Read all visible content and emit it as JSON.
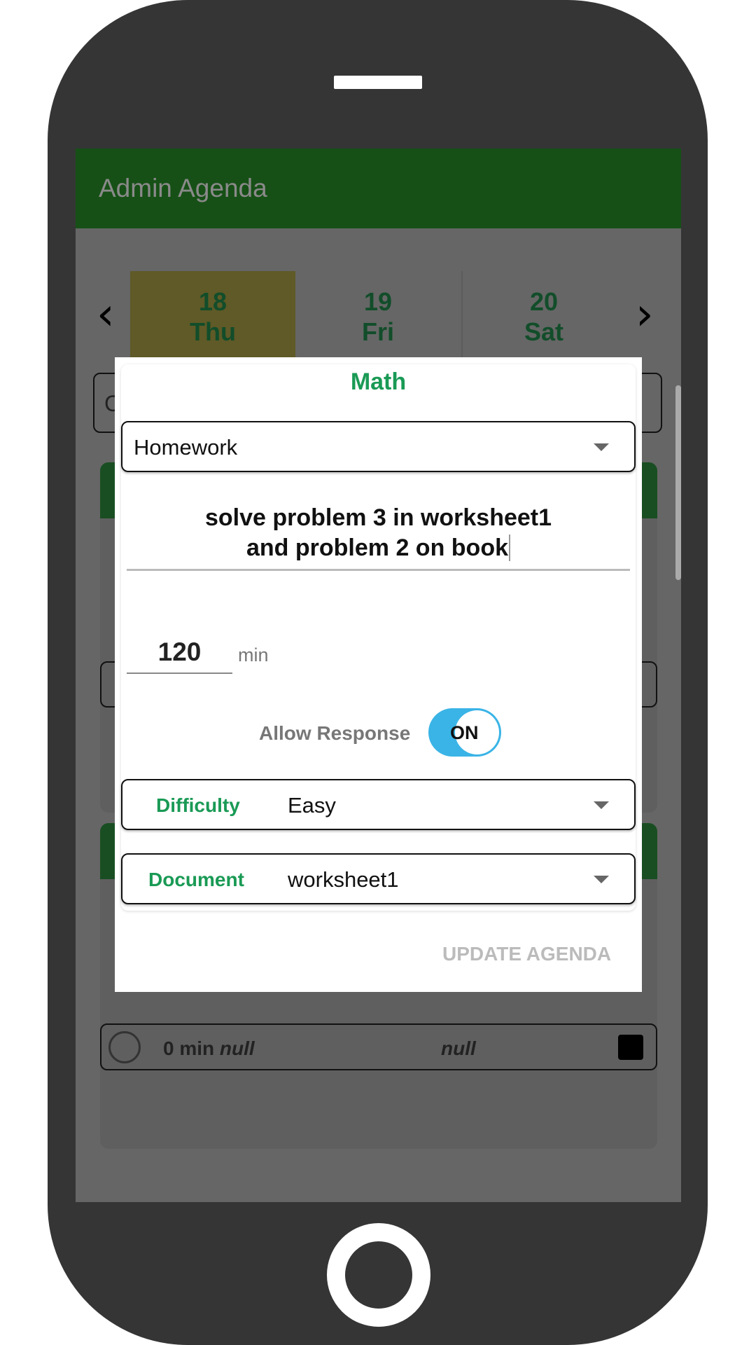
{
  "app": {
    "title": "Admin Agenda"
  },
  "dates": [
    {
      "day": "18",
      "weekday": "Thu",
      "selected": true
    },
    {
      "day": "19",
      "weekday": "Fri"
    },
    {
      "day": "20",
      "weekday": "Sat"
    }
  ],
  "background": {
    "partial_text": "C",
    "row": {
      "duration": "0 min",
      "type": "null",
      "title": "null"
    }
  },
  "dialog": {
    "subject": "Math",
    "category": "Homework",
    "description_line1": "solve problem 3 in worksheet1",
    "description_line2": "and problem 2 on book",
    "duration_value": "120",
    "duration_unit": "min",
    "allow_response_label": "Allow Response",
    "allow_response_state": "ON",
    "difficulty_label": "Difficulty",
    "difficulty_value": "Easy",
    "document_label": "Document",
    "document_value": "worksheet1",
    "update_button": "UPDATE AGENDA"
  },
  "colors": {
    "accent": "#1a9a55",
    "appbar": "#1b5e20",
    "toggle": "#3ab4e6"
  }
}
